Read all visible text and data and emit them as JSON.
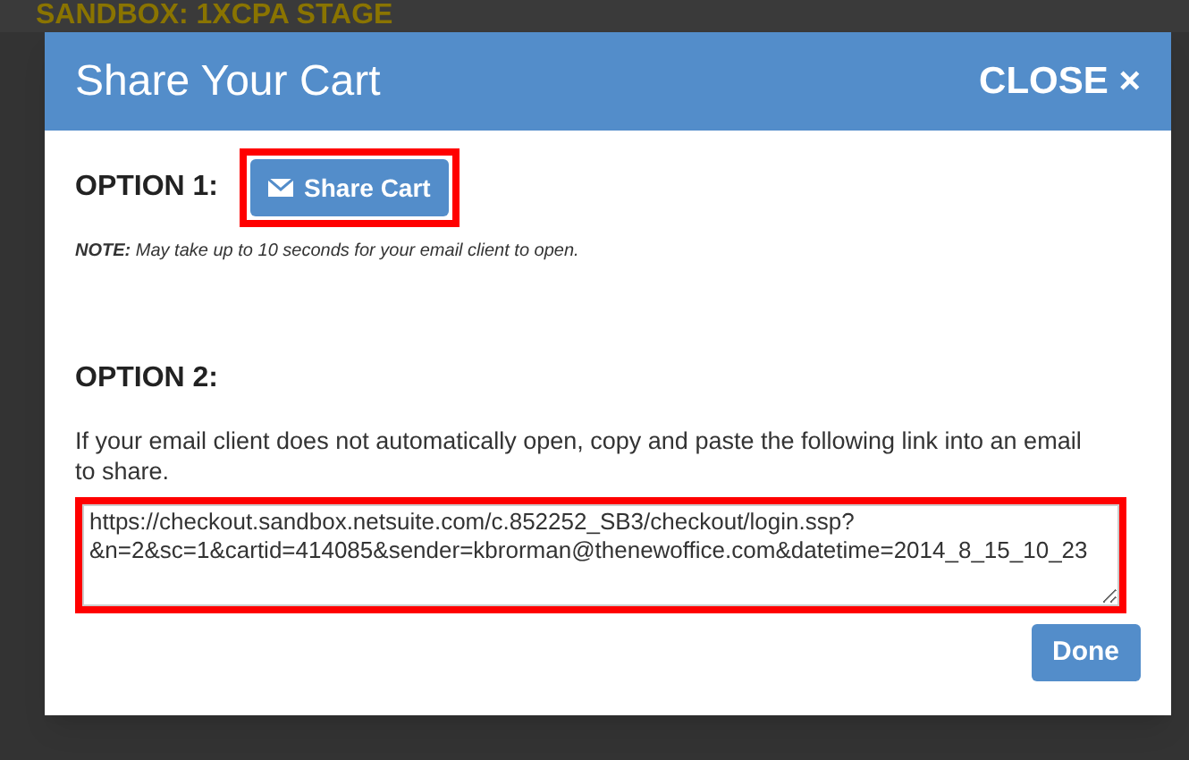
{
  "background_page": {
    "banner": "SANDBOX: 1XCPA STAGE"
  },
  "modal": {
    "title": "Share Your Cart",
    "close": "CLOSE ×",
    "option_1": {
      "label": "OPTION 1:",
      "button": "Share Cart",
      "highlighted": true,
      "note": "**NOTE:** May take up to 10 seconds for your email client to open."
    },
    "option_2": {
      "label": "OPTION 2:",
      "instructions": "If your email client does not automatically open, copy and paste the following link into an email to share.",
      "link": "https://checkout.sandbox.netsuite.com/c.852252_SB3/checkout/login.ssp?&n=2&sc=1&cartid=414085&sender=kbrorman@thenewoffice.com&datetime=2014_8_15_10_23",
      "highlighted": true
    },
    "done": "Done"
  }
}
